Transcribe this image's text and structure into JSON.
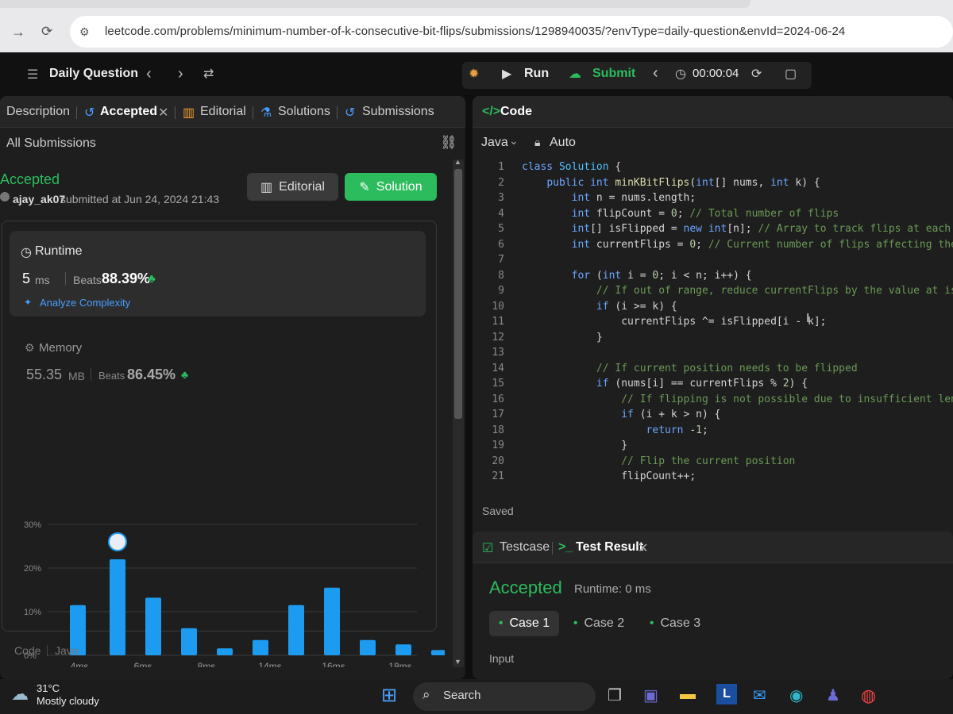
{
  "browser": {
    "url": "leetcode.com/problems/minimum-number-of-k-consecutive-bit-flips/submissions/1298940035/?envType=daily-question&envId=2024-06-24"
  },
  "topbar": {
    "daily_question": "Daily Question",
    "run": "Run",
    "submit": "Submit",
    "timer": "00:00:04"
  },
  "left": {
    "tabs": [
      "Description",
      "Accepted",
      "Editorial",
      "Solutions",
      "Submissions"
    ],
    "all_submissions": "All Submissions",
    "status": "Accepted",
    "user": "ajay_ak07",
    "submitted_text": "submitted at Jun 24, 2024 21:43",
    "editorial_btn": "Editorial",
    "solution_btn": "Solution",
    "runtime": {
      "label": "Runtime",
      "value": "5",
      "unit": "ms",
      "beats_label": "Beats",
      "beats": "88.39%",
      "analyze": "Analyze Complexity"
    },
    "memory": {
      "label": "Memory",
      "value": "55.35",
      "unit": "MB",
      "beats_label": "Beats",
      "beats": "86.45%"
    },
    "footer": {
      "code": "Code",
      "lang": "Java"
    }
  },
  "chart_data": {
    "type": "bar",
    "yticks": [
      "30%",
      "20%",
      "10%",
      "0%"
    ],
    "ylim": [
      0,
      30
    ],
    "xtick_labels": [
      "4ms",
      "6ms",
      "8ms",
      "14ms",
      "16ms",
      "18ms"
    ],
    "values": [
      11.5,
      22,
      13.2,
      6.2,
      1.6,
      3.5,
      11.5,
      15.5,
      3.5,
      2.5,
      1.2
    ],
    "highlight_index": 1,
    "overview_labels": [
      "4ms",
      "6ms",
      "8ms",
      "14ms",
      "16ms",
      "18ms"
    ],
    "accent": "#1d9bf0"
  },
  "code_panel": {
    "title": "Code",
    "language": "Java",
    "mode": "Auto",
    "saved": "Saved",
    "lines": [
      "class Solution {",
      "    public int minKBitFlips(int[] nums, int k) {",
      "        int n = nums.length;",
      "        int flipCount = 0; // Total number of flips",
      "        int[] isFlipped = new int[n]; // Array to track flips at each",
      "        int currentFlips = 0; // Current number of flips affecting the",
      "",
      "        for (int i = 0; i < n; i++) {",
      "            // If out of range, reduce currentFlips by the value at is",
      "            if (i >= k) {",
      "                currentFlips ^= isFlipped[i - k];",
      "            }",
      "",
      "            // If current position needs to be flipped",
      "            if (nums[i] == currentFlips % 2) {",
      "                // If flipping is not possible due to insufficient leng",
      "                if (i + k > n) {",
      "                    return -1;",
      "                }",
      "                // Flip the current position",
      "                flipCount++;"
    ]
  },
  "test_panel": {
    "testcase": "Testcase",
    "test_result": "Test Result",
    "status": "Accepted",
    "runtime": "Runtime: 0 ms",
    "cases": [
      "Case 1",
      "Case 2",
      "Case 3"
    ],
    "input_label": "Input"
  },
  "taskbar": {
    "weather_temp": "31°C",
    "weather_desc": "Mostly cloudy",
    "search": "Search"
  },
  "colors": {
    "accepted": "#2cbb5d",
    "submit": "#2cbb5d",
    "solution_btn": "#2cbb5d"
  }
}
